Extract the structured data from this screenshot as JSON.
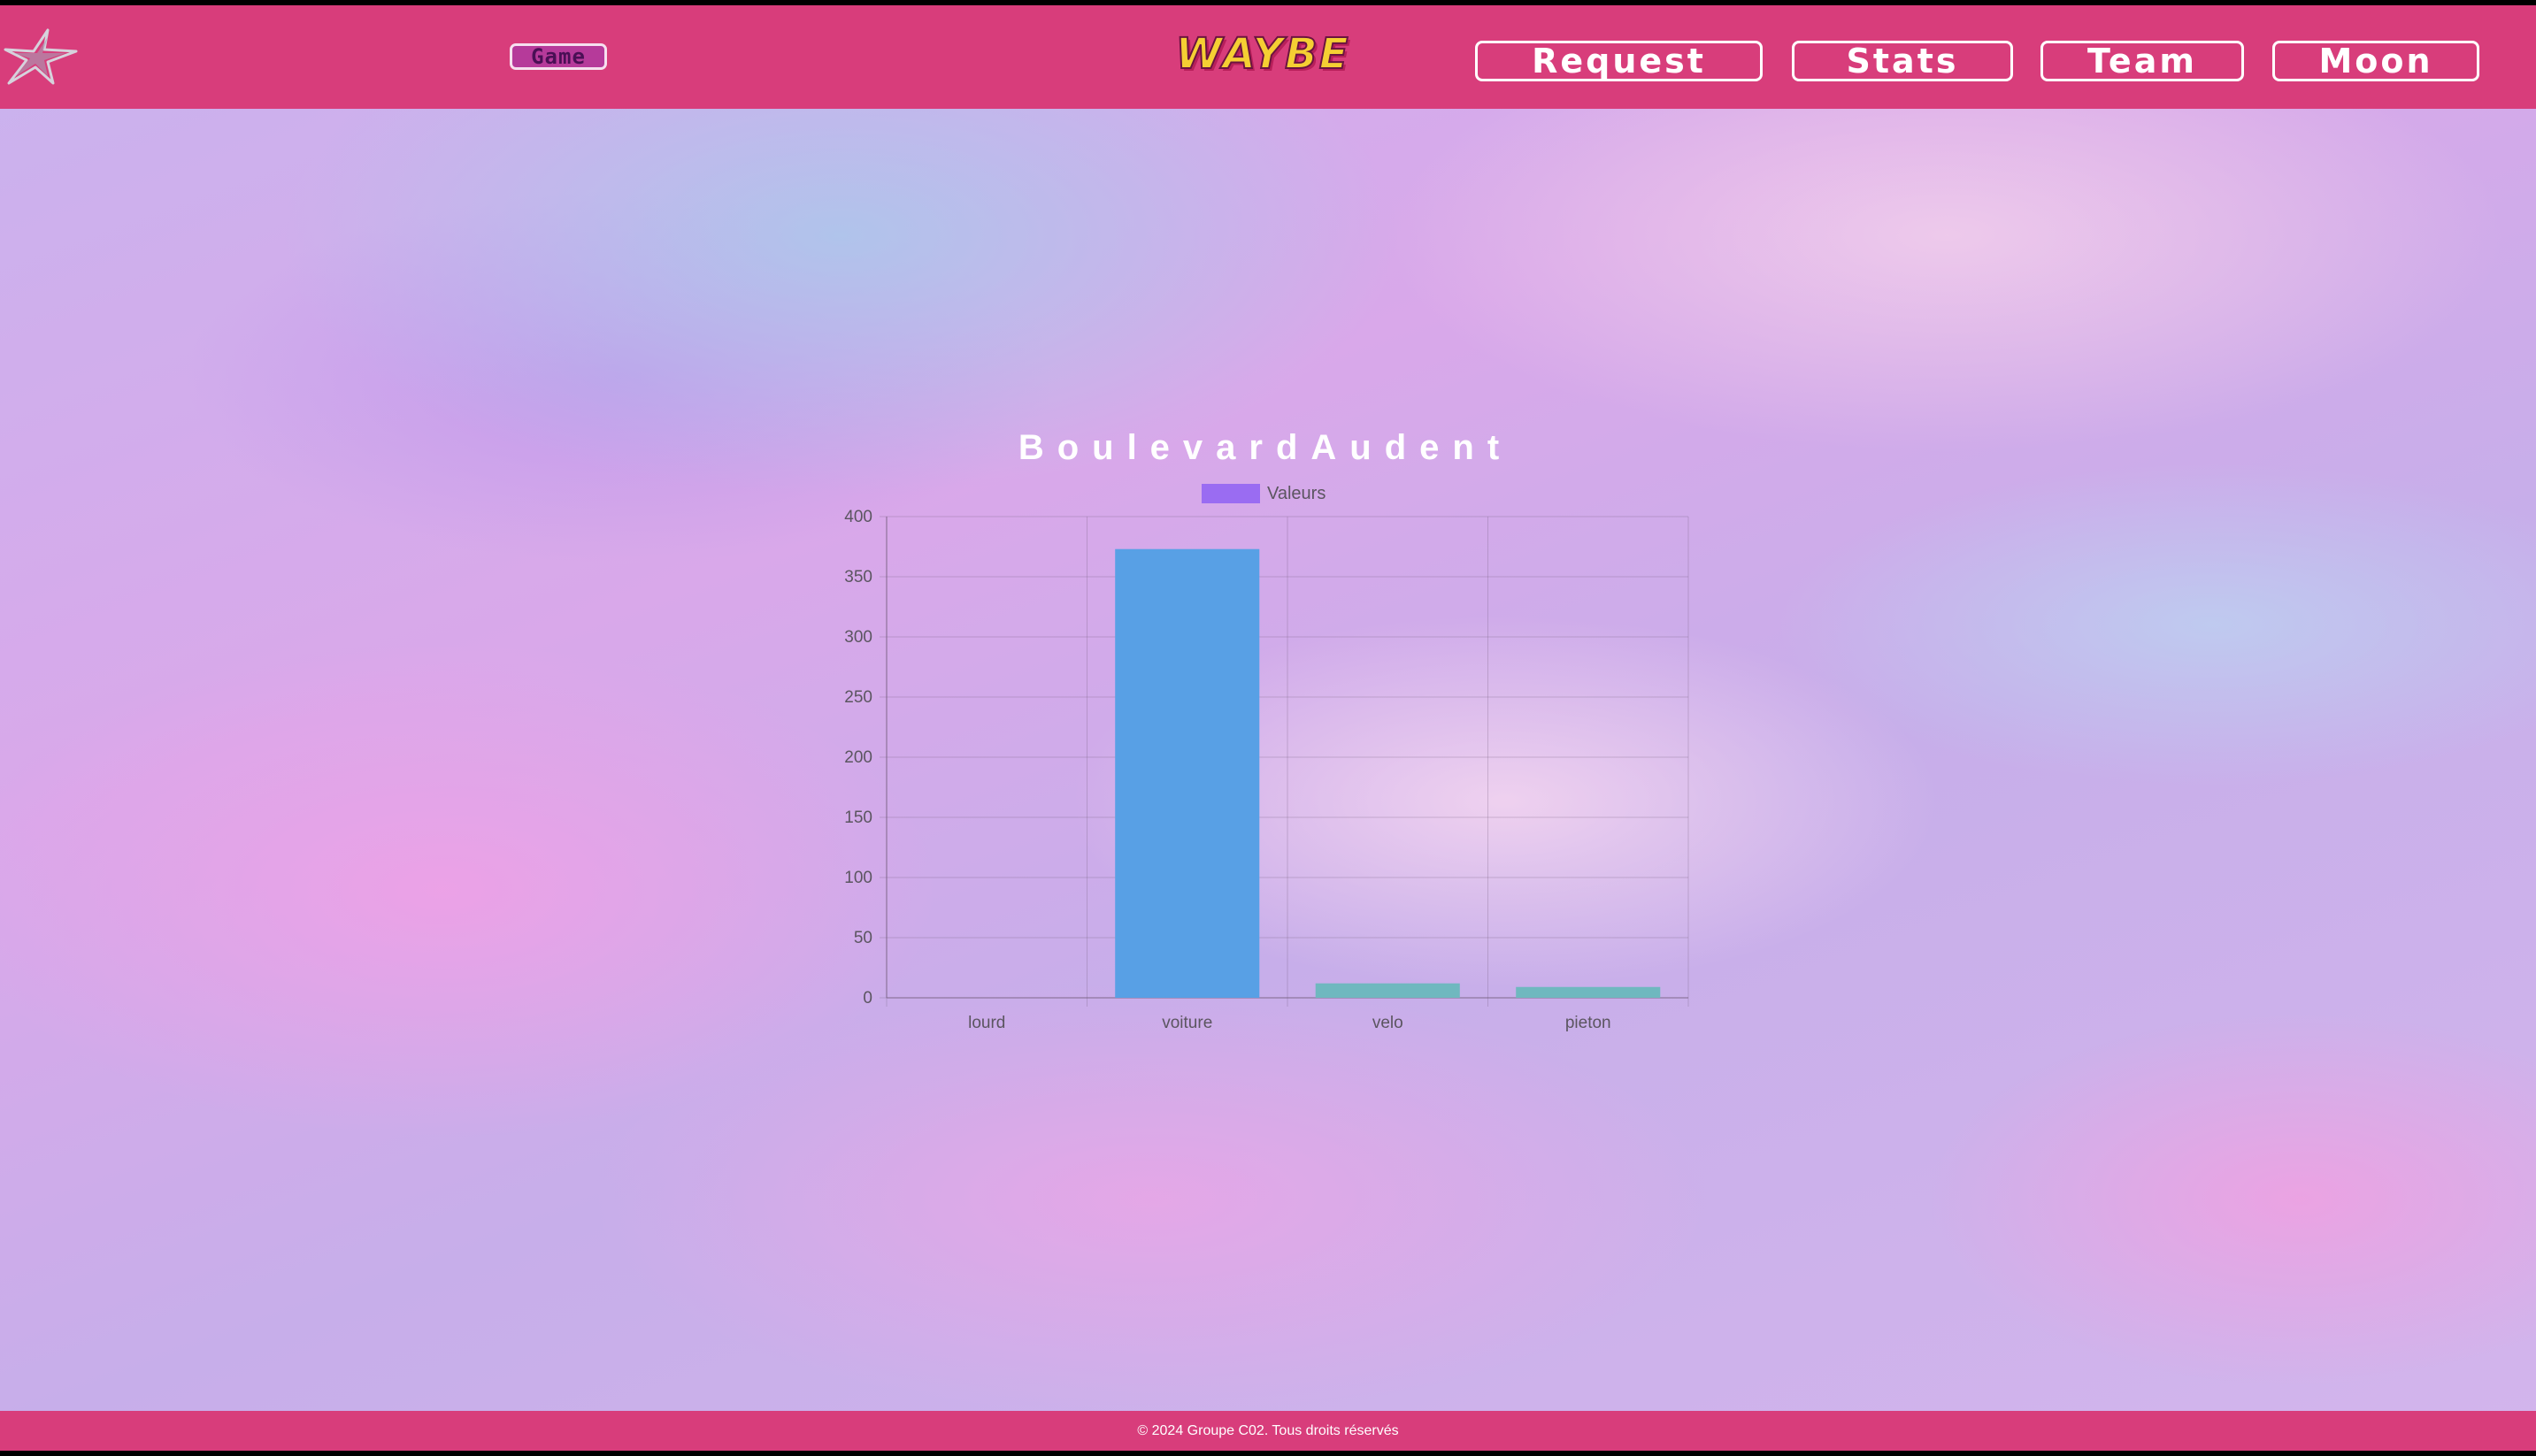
{
  "header": {
    "game_label": "Game",
    "brand": "WAYBE",
    "nav": [
      {
        "label": "Request"
      },
      {
        "label": "Stats"
      },
      {
        "label": "Team"
      },
      {
        "label": "Moon"
      }
    ]
  },
  "colors": {
    "header_bg": "#d83d7b",
    "legend_swatch": "#9a6cf2",
    "bar_primary": "#58a0e5",
    "bar_secondary": "#6fb8bf"
  },
  "chart_data": {
    "type": "bar",
    "title": "BoulevardAudent",
    "categories": [
      "lourd",
      "voiture",
      "velo",
      "pieton"
    ],
    "series": [
      {
        "name": "Valeurs",
        "values": [
          0,
          373,
          12,
          9
        ]
      }
    ],
    "ylim": [
      0,
      400
    ],
    "yticks": [
      0,
      50,
      100,
      150,
      200,
      250,
      300,
      350,
      400
    ],
    "xlabel": "",
    "ylabel": "",
    "grid": true,
    "legend": "top"
  },
  "footer": {
    "text": "© 2024 Groupe C02. Tous droits réservés"
  }
}
